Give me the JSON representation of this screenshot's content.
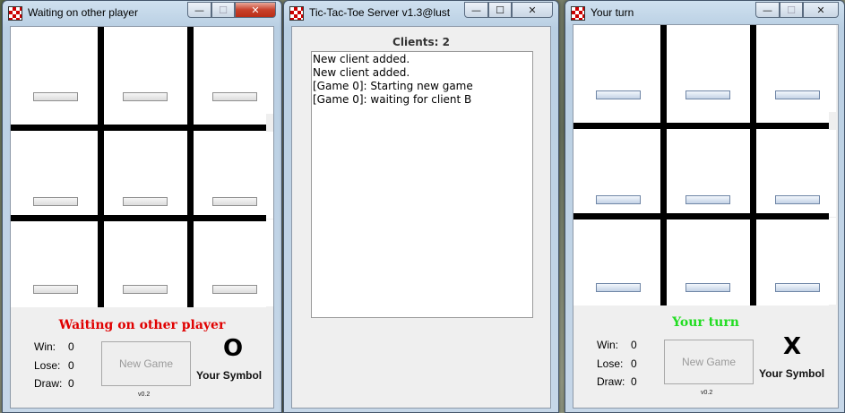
{
  "colors": {
    "waiting_status": "#e00000",
    "turn_status": "#22dd22"
  },
  "left_window": {
    "title": "Waiting on other player",
    "status": "Waiting on other player",
    "stats": {
      "win_label": "Win:",
      "win": "0",
      "lose_label": "Lose:",
      "lose": "0",
      "draw_label": "Draw:",
      "draw": "0"
    },
    "new_game_label": "New Game",
    "symbol": "O",
    "symbol_label": "Your Symbol",
    "version": "v0.2"
  },
  "server_window": {
    "title": "Tic-Tac-Toe Server v1.3@lust",
    "clients_label": "Clients: 2",
    "log": [
      "New client added.",
      "New client added.",
      "[Game 0]: Starting new game",
      "[Game 0]: waiting for client B"
    ]
  },
  "right_window": {
    "title": "Your turn",
    "status": "Your turn",
    "stats": {
      "win_label": "Win:",
      "win": "0",
      "lose_label": "Lose:",
      "lose": "0",
      "draw_label": "Draw:",
      "draw": "0"
    },
    "new_game_label": "New Game",
    "symbol": "X",
    "symbol_label": "Your Symbol",
    "version": "v0.2"
  },
  "window_controls": {
    "minimize": "—",
    "maximize": "☐",
    "close": "✕"
  }
}
